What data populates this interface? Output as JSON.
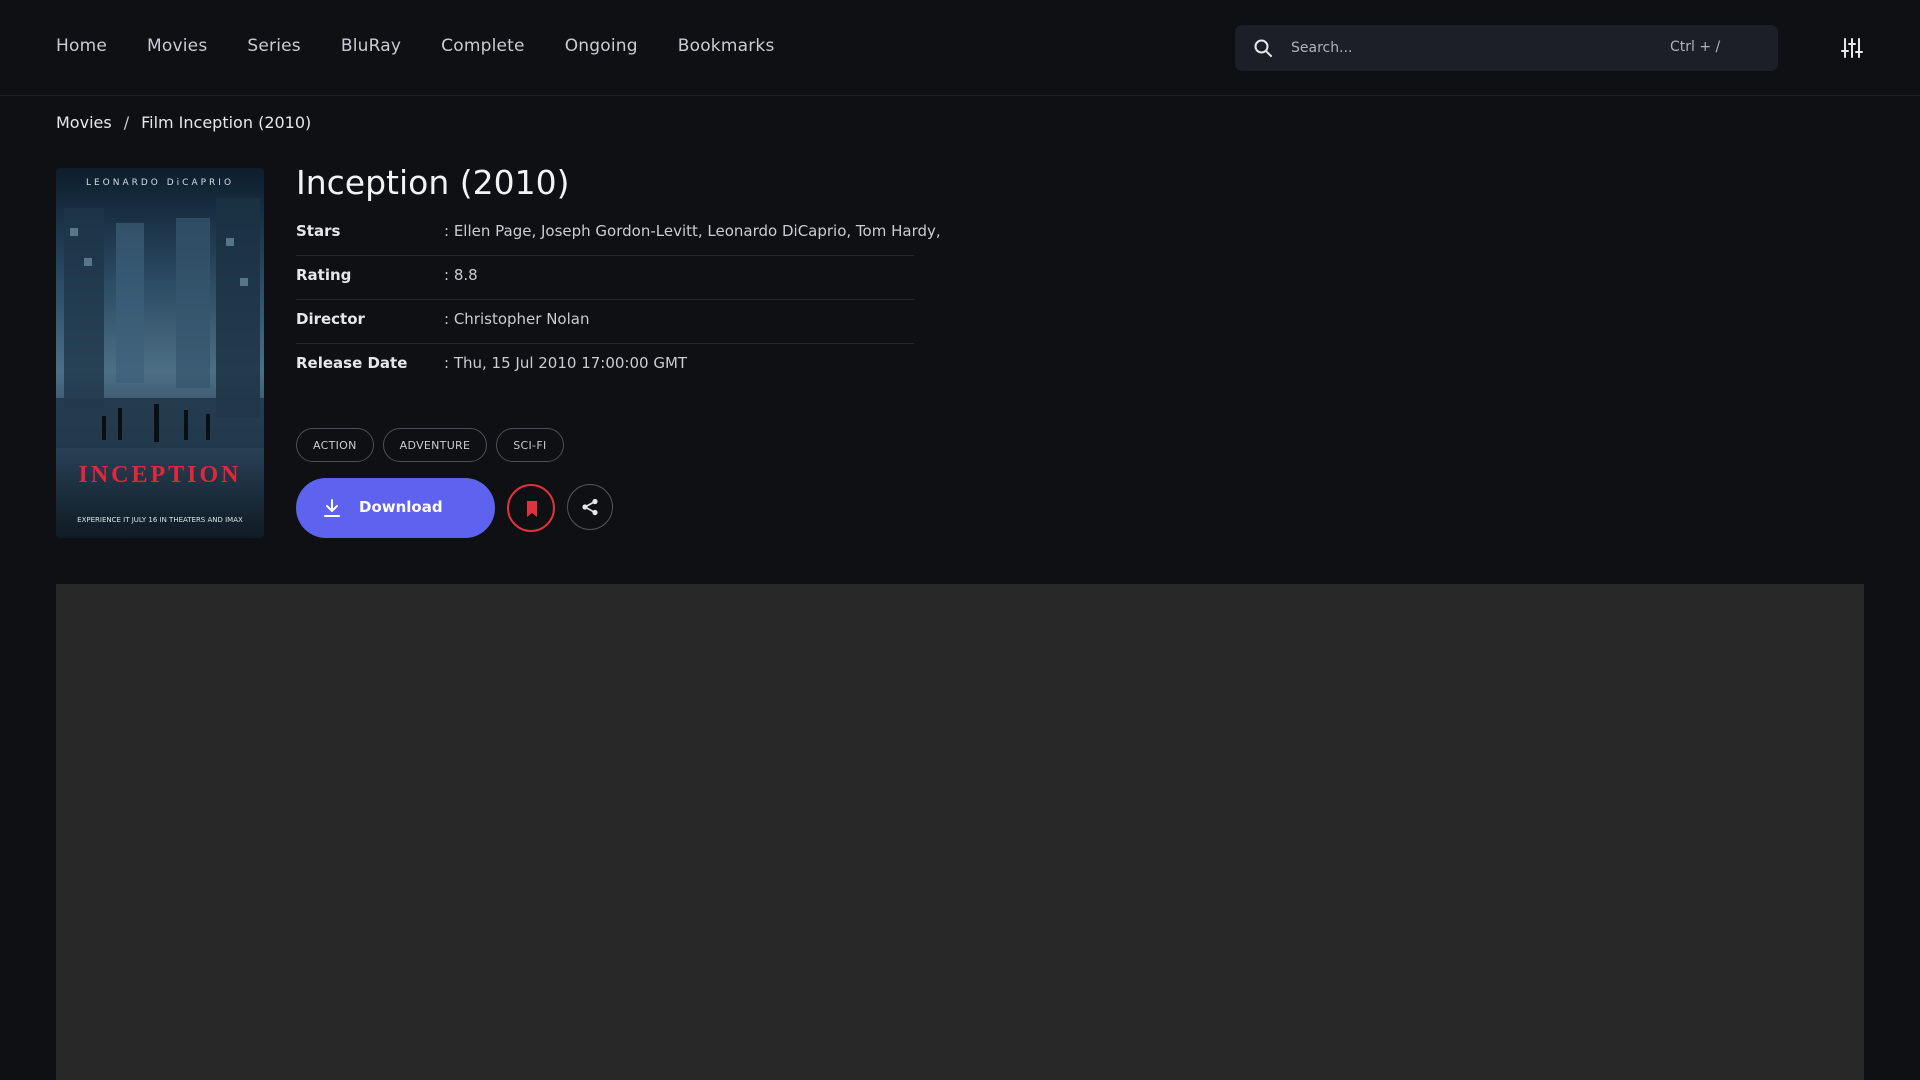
{
  "nav": {
    "items": [
      "Home",
      "Movies",
      "Series",
      "BluRay",
      "Complete",
      "Ongoing",
      "Bookmarks"
    ]
  },
  "search": {
    "placeholder": "Search...",
    "shortcut": "Ctrl + /",
    "icon": "search-icon"
  },
  "filter": {
    "icon": "sliders-icon"
  },
  "breadcrumb": {
    "parent": "Movies",
    "separator": "/",
    "current": "Film Inception (2010)"
  },
  "poster": {
    "actor_line": "LEONARDO DiCAPRIO",
    "title_text": "INCEPTION",
    "tagline": "EXPERIENCE IT JULY 16 IN THEATERS AND IMAX"
  },
  "movie": {
    "title": "Inception (2010)",
    "info": [
      {
        "label": "Stars",
        "value": ": Ellen Page, Joseph Gordon-Levitt, Leonardo DiCaprio, Tom Hardy,"
      },
      {
        "label": "Rating",
        "value": ": 8.8"
      },
      {
        "label": "Director",
        "value": ": Christopher Nolan"
      },
      {
        "label": "Release Date",
        "value": ": Thu, 15 Jul 2010 17:00:00 GMT"
      }
    ],
    "genres": [
      "ACTION",
      "ADVENTURE",
      "SCI-FI"
    ]
  },
  "actions": {
    "download_label": "Download",
    "download_icon": "download-icon",
    "bookmark_icon": "bookmark-icon",
    "share_icon": "share-icon"
  },
  "colors": {
    "background": "#0f1013",
    "accent": "#5e63ef",
    "bookmark": "#e0323e",
    "player": "#282828"
  }
}
